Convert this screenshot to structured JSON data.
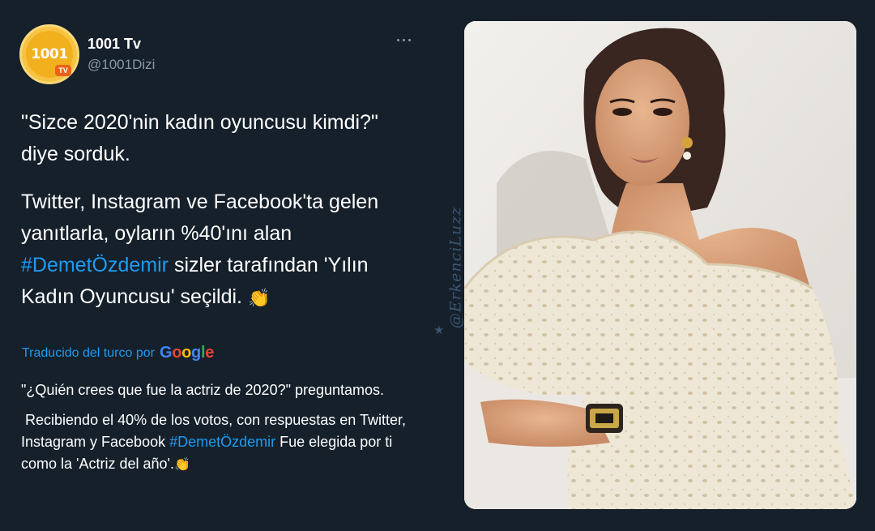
{
  "author": {
    "display_name": "1001 Tv",
    "handle": "@1001Dizi",
    "avatar_text": "1001",
    "avatar_badge": "TV"
  },
  "tweet": {
    "paragraph1": "\"Sizce 2020'nin kadın oyuncusu kimdi?\" diye sorduk.",
    "paragraph2_before": "Twitter, Instagram ve Facebook'ta gelen yanıtlarla, oyların %40'ını alan ",
    "paragraph2_hashtag": "#DemetÖzdemir",
    "paragraph2_after": " sizler tarafından 'Yılın Kadın Oyuncusu' seçildi.",
    "emoji": "👏"
  },
  "translation": {
    "label": "Traducido del turco por",
    "brand": [
      "G",
      "o",
      "o",
      "g",
      "l",
      "e"
    ],
    "paragraph1": "\"¿Quién crees que fue la actriz de 2020?\" preguntamos.",
    "paragraph2_before": "Recibiendo el 40% de los votos, con respuestas en Twitter, Instagram y Facebook ",
    "paragraph2_hashtag": "#DemetÖzdemir",
    "paragraph2_after": " Fue elegida por ti como la 'Actriz del año'.",
    "emoji": "👏"
  },
  "watermark": "@ErkenciLuzz",
  "colors": {
    "background": "#15202b",
    "link": "#1d9bf0",
    "secondary_text": "#8899a6"
  },
  "icons": {
    "more": "more-horizontal-icon",
    "watermark_star": "star-icon"
  }
}
